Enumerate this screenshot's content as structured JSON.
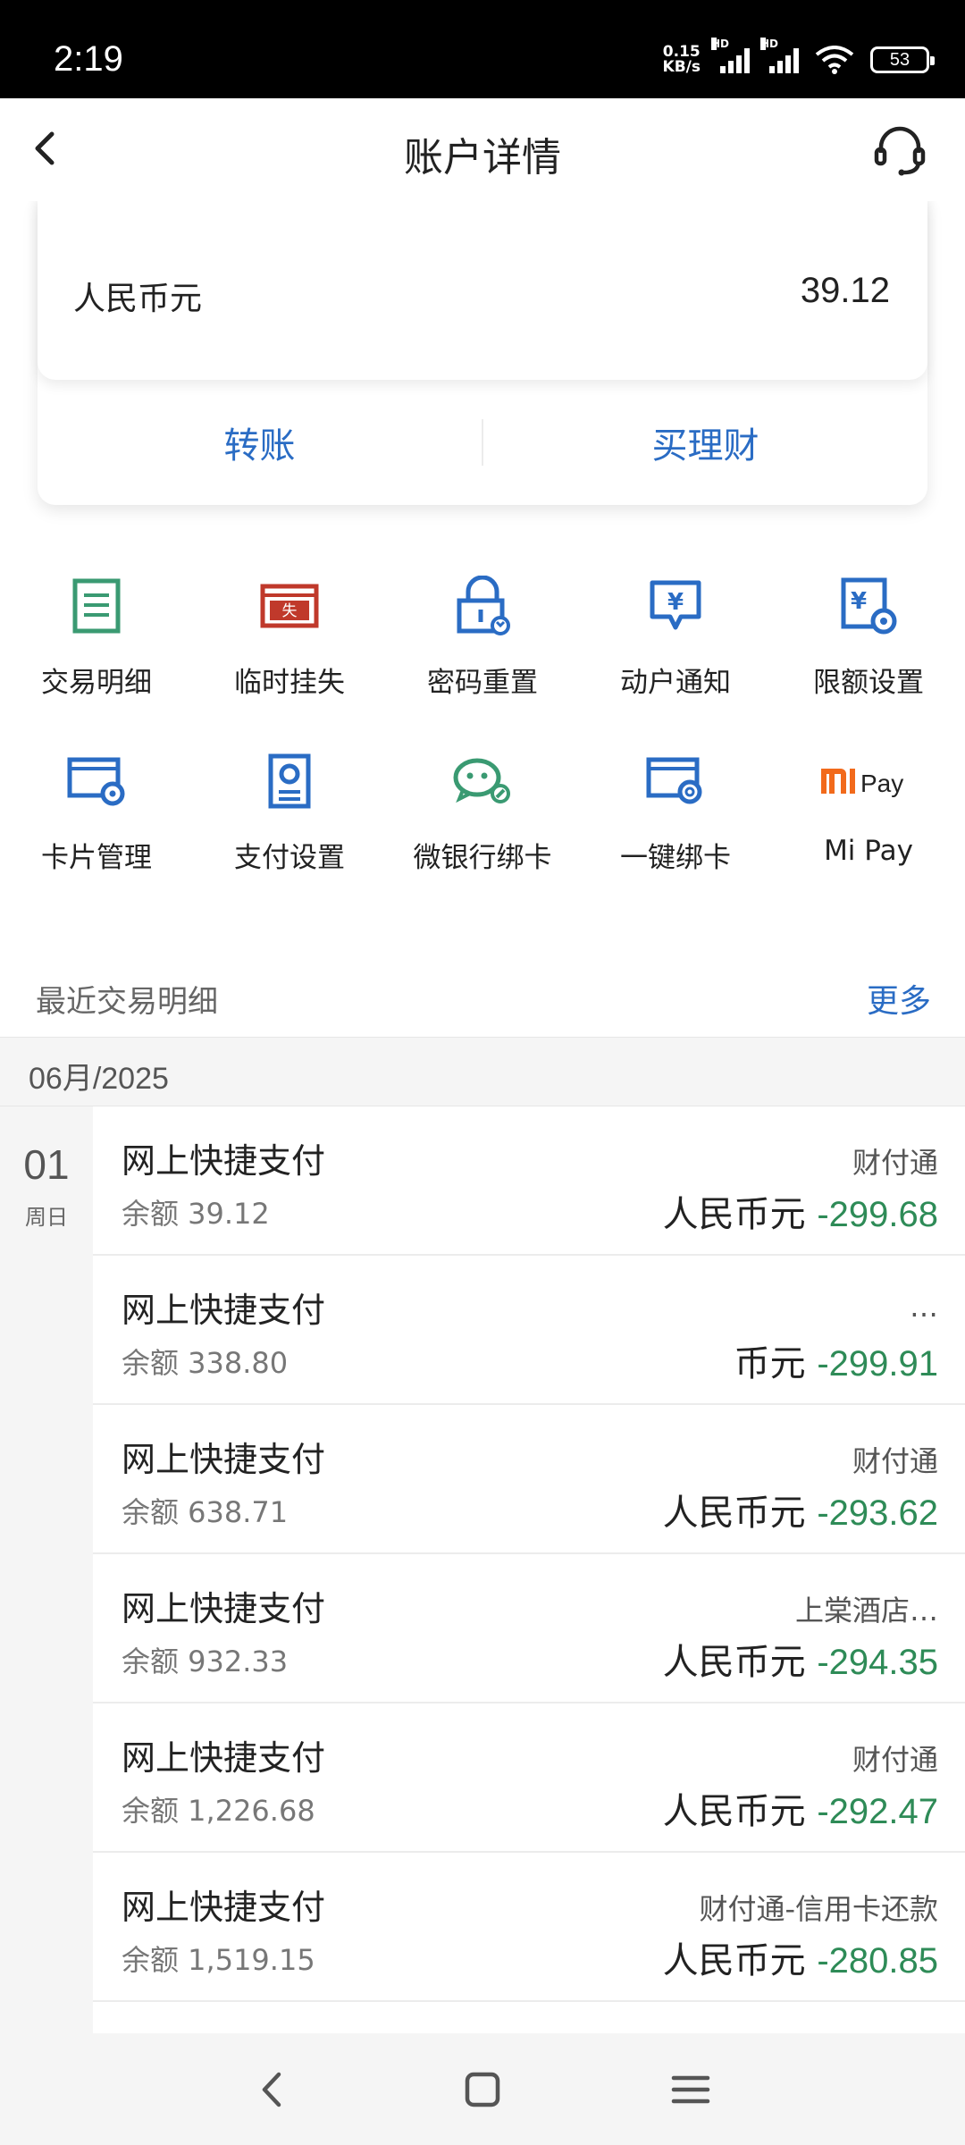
{
  "status_bar": {
    "time": "2:19",
    "net_speed_value": "0.15",
    "net_speed_unit": "KB/s",
    "signal_tag": "HD",
    "battery": "53"
  },
  "header": {
    "title": "账户详情"
  },
  "balance_card": {
    "currency": "人民币元",
    "balance": "39.12",
    "action_transfer": "转账",
    "action_wealth": "买理财"
  },
  "grid": {
    "items": [
      {
        "label": "交易明细",
        "icon": "list-document-icon",
        "color": "#3a9a72"
      },
      {
        "label": "临时挂失",
        "icon": "card-lost-icon",
        "color": "#c0392b",
        "glyph": "失"
      },
      {
        "label": "密码重置",
        "icon": "lock-reset-icon",
        "color": "#2a6cc4"
      },
      {
        "label": "动户通知",
        "icon": "yuan-message-icon",
        "color": "#2a6cc4",
        "glyph": "¥"
      },
      {
        "label": "限额设置",
        "icon": "yuan-gear-icon",
        "color": "#2a6cc4",
        "glyph": "¥"
      },
      {
        "label": "卡片管理",
        "icon": "card-gear-icon",
        "color": "#2a6cc4"
      },
      {
        "label": "支付设置",
        "icon": "pay-settings-icon",
        "color": "#2a6cc4"
      },
      {
        "label": "微银行绑卡",
        "icon": "wechat-link-icon",
        "color": "#3a9a72"
      },
      {
        "label": "一键绑卡",
        "icon": "card-search-icon",
        "color": "#2a6cc4"
      },
      {
        "label": "Mi Pay",
        "icon": "mi-pay-logo-icon",
        "color": "#f26a1b",
        "logo_text": "Pay"
      }
    ]
  },
  "recent": {
    "title": "最近交易明细",
    "more": "更多"
  },
  "month": "06月/2025",
  "date": {
    "day": "01",
    "weekday": "周日"
  },
  "transactions": [
    {
      "name": "网上快捷支付",
      "balance": "余额 39.12",
      "merchant": "财付通",
      "currency": "人民币元",
      "amount": "-299.68"
    },
    {
      "name": "网上快捷支付",
      "balance": "余额 338.80",
      "merchant": "…",
      "currency": "币元",
      "amount": "-299.91"
    },
    {
      "name": "网上快捷支付",
      "balance": "余额 638.71",
      "merchant": "财付通",
      "currency": "人民币元",
      "amount": "-293.62"
    },
    {
      "name": "网上快捷支付",
      "balance": "余额 932.33",
      "merchant": "上棠酒店…",
      "currency": "人民币元",
      "amount": "-294.35"
    },
    {
      "name": "网上快捷支付",
      "balance": "余额 1,226.68",
      "merchant": "财付通",
      "currency": "人民币元",
      "amount": "-292.47"
    },
    {
      "name": "网上快捷支付",
      "balance": "余额 1,519.15",
      "merchant": "财付通-信用卡还款",
      "currency": "人民币元",
      "amount": "-280.85"
    }
  ]
}
